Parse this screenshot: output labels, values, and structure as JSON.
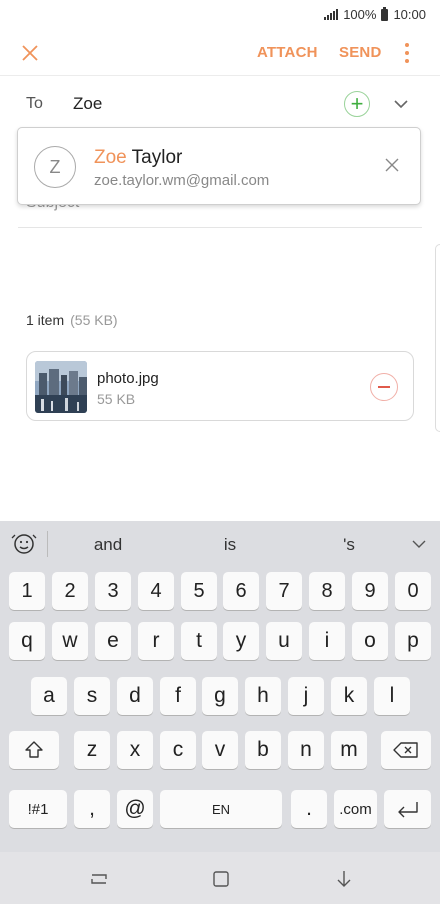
{
  "status_bar": {
    "battery": "100%",
    "time": "10:00"
  },
  "toolbar": {
    "attach_label": "ATTACH",
    "send_label": "SEND",
    "accent": "#f0935a"
  },
  "to_field": {
    "label": "To",
    "value": "Zoe"
  },
  "suggestion": {
    "avatar_initial": "Z",
    "name_match": "Zoe",
    "name_rest": " Taylor",
    "email": "zoe.taylor.wm@gmail.com"
  },
  "subject": {
    "placeholder": "Subject"
  },
  "attachments": {
    "count_label": "1 item",
    "total_size": "(55 KB)",
    "items": [
      {
        "name": "photo.jpg",
        "size": "55 KB"
      }
    ]
  },
  "keyboard": {
    "suggestions": [
      "and",
      "is",
      "'s"
    ],
    "number_row": [
      "1",
      "2",
      "3",
      "4",
      "5",
      "6",
      "7",
      "8",
      "9",
      "0"
    ],
    "row1": [
      "q",
      "w",
      "e",
      "r",
      "t",
      "y",
      "u",
      "i",
      "o",
      "p"
    ],
    "row2": [
      "a",
      "s",
      "d",
      "f",
      "g",
      "h",
      "j",
      "k",
      "l"
    ],
    "row3": [
      "z",
      "x",
      "c",
      "v",
      "b",
      "n",
      "m"
    ],
    "symbols_label": "!#1",
    "comma": ",",
    "at": "@",
    "space_label": "EN",
    "period": ".",
    "dotcom": ".com"
  }
}
